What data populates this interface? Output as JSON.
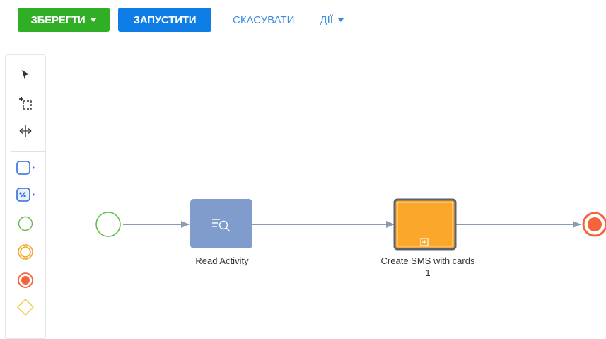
{
  "toolbar": {
    "save_label": "ЗБЕРЕГТИ",
    "run_label": "ЗАПУСТИТИ",
    "cancel_label": "СКАСУВАТИ",
    "actions_label": "ДІЇ"
  },
  "palette": {
    "tools": [
      {
        "icon": "pointer-icon"
      },
      {
        "icon": "lasso-select-icon"
      },
      {
        "icon": "space-tool-icon"
      }
    ],
    "elements": [
      {
        "icon": "task-rounded-rect-icon"
      },
      {
        "icon": "subprocess-icon"
      },
      {
        "icon": "start-event-icon"
      },
      {
        "icon": "intermediate-event-icon"
      },
      {
        "icon": "end-event-icon"
      },
      {
        "icon": "gateway-icon"
      }
    ]
  },
  "diagram": {
    "nodes": [
      {
        "id": "start",
        "type": "start-event"
      },
      {
        "id": "read",
        "type": "task",
        "label": "Read Activity"
      },
      {
        "id": "sub",
        "type": "subprocess",
        "label_line1": "Create SMS with cards",
        "label_line2": "1"
      },
      {
        "id": "end",
        "type": "end-event"
      }
    ]
  },
  "colors": {
    "save": "#2fae26",
    "run": "#0e7ee6",
    "link": "#3d8ce0",
    "task": "#7f9ccd",
    "subprocess": "#faa72c",
    "start": "#5fbe4c",
    "intermediate": "#f5a623",
    "end": "#f4643a",
    "gateway": "#f5c842",
    "flow": "#8a9bb3"
  }
}
